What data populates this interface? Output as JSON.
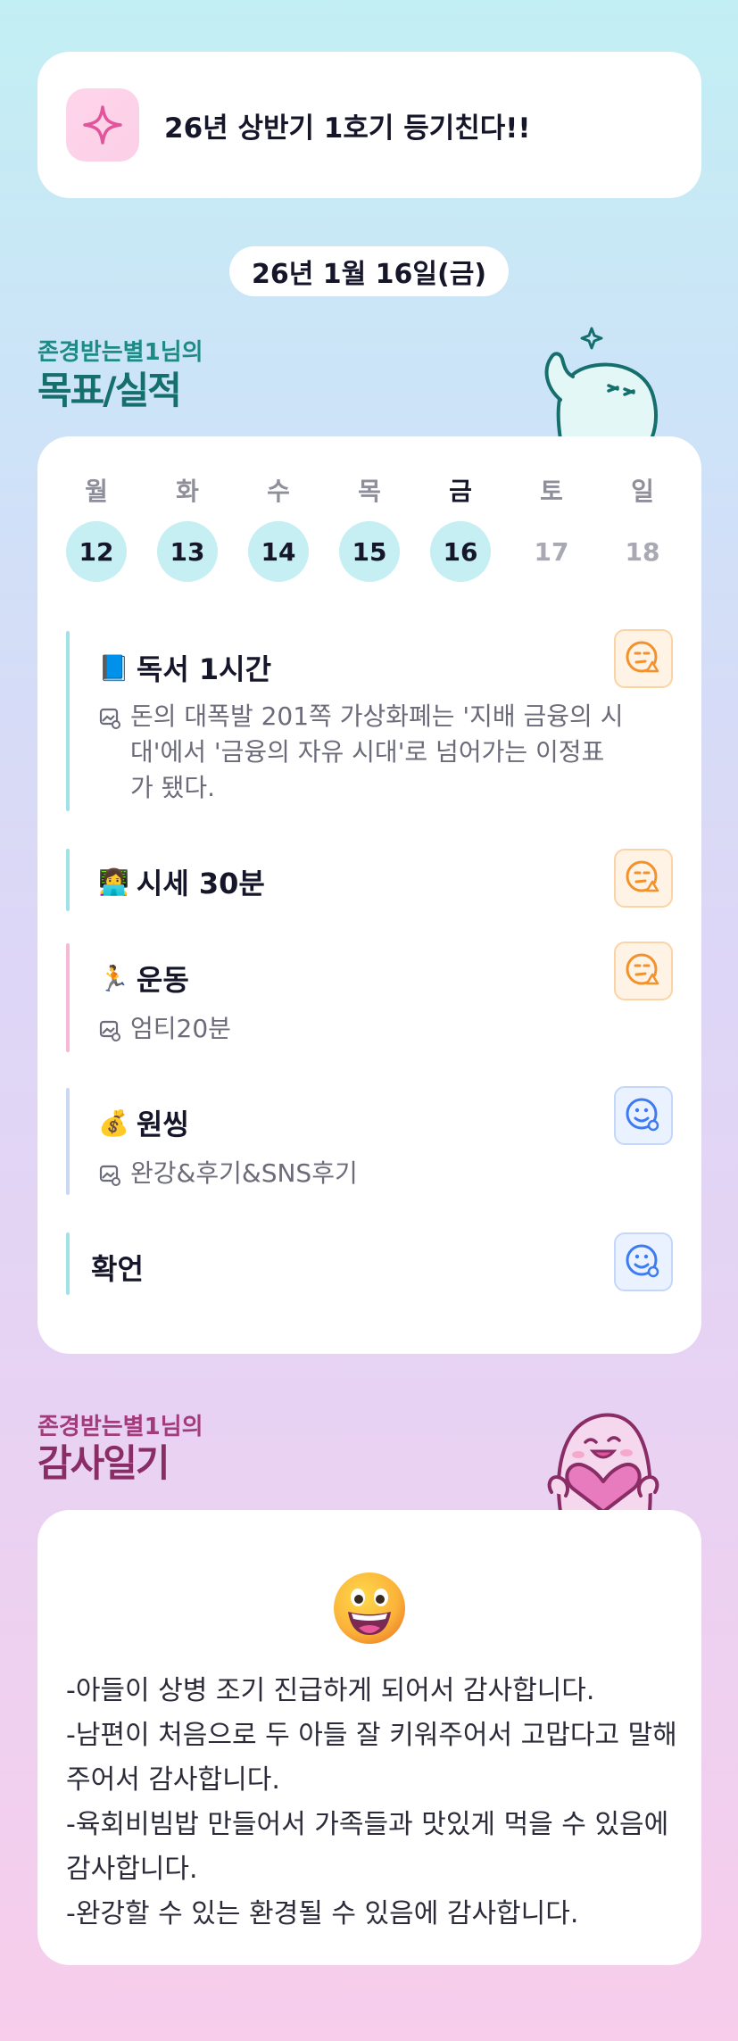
{
  "banner": {
    "text": "26년 상반기 1호기 등기친다!!",
    "icon": "sparkle-icon"
  },
  "date": "26년 1월 16일(금)",
  "goals_section": {
    "owner": "존경받는별1님의",
    "title": "목표/실적"
  },
  "week": [
    {
      "day": "월",
      "date": "12",
      "active": true
    },
    {
      "day": "화",
      "date": "13",
      "active": true
    },
    {
      "day": "수",
      "date": "14",
      "active": true
    },
    {
      "day": "목",
      "date": "15",
      "active": true
    },
    {
      "day": "금",
      "date": "16",
      "active": true,
      "today": true
    },
    {
      "day": "토",
      "date": "17",
      "active": false
    },
    {
      "day": "일",
      "date": "18",
      "active": false
    }
  ],
  "goals": [
    {
      "emoji": "📘",
      "title": "독서 1시간",
      "note": "돈의 대폭발 201쪽 가상화폐는 '지배 금융의 시대'에서 '금융의 자유 시대'로 넘어가는 이정표가 됐다.",
      "status": "partial",
      "bar_color": "#9fe3e6"
    },
    {
      "emoji": "👩‍💻",
      "title": "시세 30분",
      "note": "",
      "status": "partial",
      "bar_color": "#9fe3e6"
    },
    {
      "emoji": "🏃",
      "title": "운동",
      "note": "엄티20분",
      "status": "partial",
      "bar_color": "#f6b8d6"
    },
    {
      "emoji": "💰",
      "title": "원씽",
      "note": "완강&후기&SNS후기",
      "status": "done",
      "bar_color": "#c9d9f2"
    },
    {
      "emoji": "",
      "title": "확언",
      "note": "",
      "status": "done",
      "bar_color": "#9fe3e6"
    }
  ],
  "colors": {
    "partial": "#f3922c",
    "done": "#3e7bf0",
    "accent_teal": "#1d8a86",
    "accent_plum": "#a23b7a"
  },
  "thanks_section": {
    "owner": "존경받는별1님의",
    "title": "감사일기"
  },
  "thanks": {
    "mood_icon": "grinning-face-icon",
    "lines": [
      "-아들이 상병 조기 진급하게 되어서 감사합니다.",
      "-남편이 처음으로 두 아들 잘 키워주어서 고맙다고 말해주어서 감사합니다.",
      "-육회비빔밥 만들어서 가족들과 맛있게 먹을 수 있음에 감사합니다.",
      "-완강할 수 있는 환경될 수 있음에 감사합니다."
    ]
  }
}
